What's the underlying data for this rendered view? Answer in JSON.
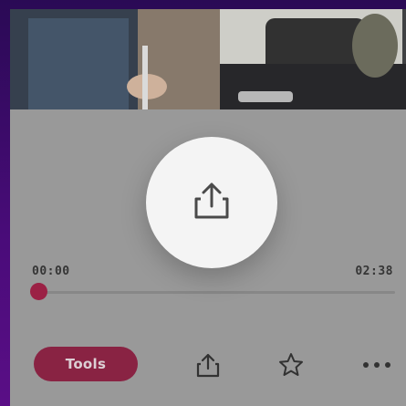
{
  "player": {
    "time_elapsed": "00:00",
    "time_total": "02:38",
    "progress": 0.0
  },
  "actions": {
    "tools_label": "Tools"
  },
  "icons": {
    "fab": "share-icon",
    "toolbar": [
      "share-icon",
      "star-icon",
      "more-options-icon"
    ]
  },
  "colors": {
    "accent": "#a01840",
    "tools_button": "#8c1a3e",
    "overlay": "#9d9d9d",
    "fab": "#f4f4f4"
  }
}
